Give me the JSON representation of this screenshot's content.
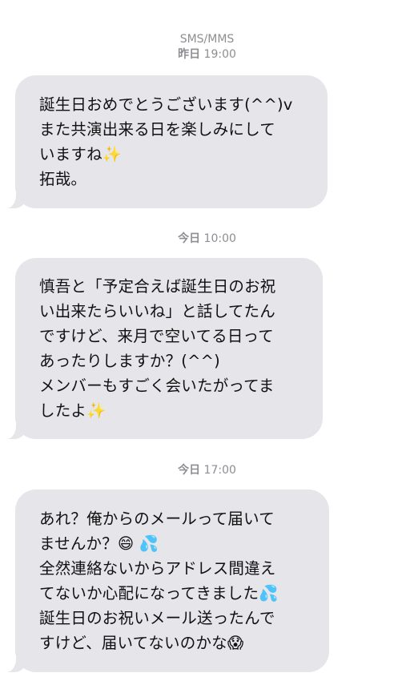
{
  "thread": {
    "channel_label": "SMS/MMS",
    "groups": [
      {
        "day": "昨日",
        "time": "19:00",
        "lines": [
          "誕生日おめでとうございます(^^)v",
          "また共演出来る日を楽しみにして",
          "いますね✨",
          "拓哉。"
        ]
      },
      {
        "day": "今日",
        "time": "10:00",
        "lines": [
          "慎吾と「予定合えば誕生日のお祝",
          "い出来たらいいね」と話してたん",
          "ですけど、来月で空いてる日って",
          "あったりしますか？(^^)",
          "メンバーもすごく会いたがってま",
          "したよ✨"
        ]
      },
      {
        "day": "今日",
        "time": "17:00",
        "lines": [
          "あれ？俺からのメールって届いて",
          "ませんか？😄 💦",
          "全然連絡ないからアドレス間違え",
          "てないか心配になってきました💦",
          "誕生日のお祝いメール送ったんで",
          "すけど、届いてないのかな😱"
        ]
      }
    ]
  }
}
